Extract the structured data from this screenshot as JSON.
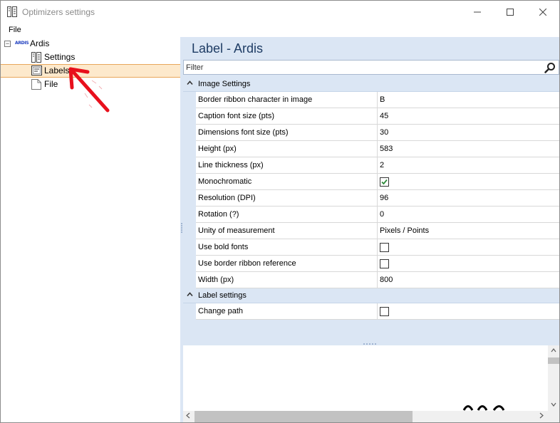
{
  "window": {
    "title": "Optimizers settings",
    "minimize": "—",
    "maximize": "☐",
    "close": "✕"
  },
  "menu": {
    "file": "File"
  },
  "tree": {
    "root": {
      "expander": "−",
      "logo": "ARDIS",
      "label": "Ardis"
    },
    "items": [
      {
        "label": "Settings",
        "icon": "settings-icon"
      },
      {
        "label": "Labels",
        "icon": "labels-icon",
        "selected": true
      },
      {
        "label": "File",
        "icon": "file-icon"
      }
    ]
  },
  "panel": {
    "title": "Label - Ardis",
    "filter_placeholder": "Filter"
  },
  "sections": [
    {
      "label": "Image Settings",
      "rows": [
        {
          "name": "Border ribbon character in image",
          "value": "B"
        },
        {
          "name": "Caption font size (pts)",
          "value": "45"
        },
        {
          "name": "Dimensions font size (pts)",
          "value": "30"
        },
        {
          "name": "Height (px)",
          "value": "583"
        },
        {
          "name": "Line thickness (px)",
          "value": "2"
        },
        {
          "name": "Monochromatic",
          "checked": true
        },
        {
          "name": "Resolution (DPI)",
          "value": "96"
        },
        {
          "name": "Rotation (?)",
          "value": "0"
        },
        {
          "name": "Unity of measurement",
          "value": "Pixels / Points"
        },
        {
          "name": "Use bold fonts",
          "checked": false
        },
        {
          "name": "Use border ribbon reference",
          "checked": false
        },
        {
          "name": "Width (px)",
          "value": "800"
        }
      ]
    },
    {
      "label": "Label settings",
      "rows": [
        {
          "name": "Change path",
          "checked": false
        }
      ]
    }
  ],
  "colors": {
    "panel_bg": "#dbe6f4",
    "title_color": "#1e3c64",
    "selection_bg": "#fde9cc",
    "selection_border": "#e8a65a",
    "check_color": "#2e8b3a",
    "annotation_arrow": "#e8101c"
  }
}
